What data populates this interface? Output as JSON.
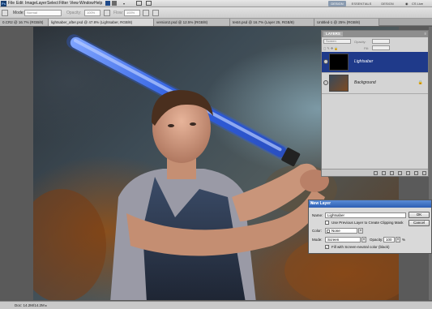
{
  "menubar": {
    "logo": "Ps",
    "items": [
      "File",
      "Edit",
      "Image",
      "Layer",
      "Select",
      "Filter",
      "View",
      "Window",
      "Help"
    ],
    "workspaces": [
      "DESIGN",
      "ESSENTIALS",
      "DESIGN"
    ],
    "cs_live": "CS Live"
  },
  "options": {
    "mode_label": "Mode:",
    "mode_value": "Normal",
    "opacity_label": "Opacity:",
    "opacity_value": "100%",
    "flow_label": "Flow:",
    "flow_value": "100%"
  },
  "tabs": [
    {
      "label": "0.CR2 @ 16.7% (RGB/8)"
    },
    {
      "label": "lightsaber_after.psd @ 47.8% (Lightsaber, RGB/8)"
    },
    {
      "label": "version2.psd @ 12.5% (RGB/8)"
    },
    {
      "label": "test4.psd @ 16.7% (Layer 25, RGB/8)"
    },
    {
      "label": "Untitled-1 @ 25% (RGB/8)"
    }
  ],
  "layers_panel": {
    "title": "LAYERS",
    "blend_mode": "Screen",
    "opacity_label": "Opacity:",
    "fill_label": "Fill:",
    "layers": [
      {
        "name": "Lightsaber",
        "selected": true
      },
      {
        "name": "Background",
        "selected": false
      }
    ]
  },
  "new_layer_dialog": {
    "title": "New Layer",
    "name_label": "Name:",
    "name_value": "Lightsaber",
    "use_previous_label": "Use Previous Layer to Create Clipping Mask",
    "color_label": "Color:",
    "color_value": "None",
    "mode_label": "Mode:",
    "mode_value": "Screen",
    "opacity_label": "Opacity:",
    "opacity_value": "100",
    "opacity_unit": "%",
    "fill_neutral_label": "Fill with Screen-neutral color (black)",
    "ok_label": "OK",
    "cancel_label": "Cancel"
  },
  "status": {
    "zoom": "",
    "doc_size": "Doc: 14.2M/14.2M"
  },
  "colors": {
    "selection": "#1f3a8a",
    "dialog_title": "#2c5fb3",
    "saber_blue": "#2f5fe0"
  }
}
